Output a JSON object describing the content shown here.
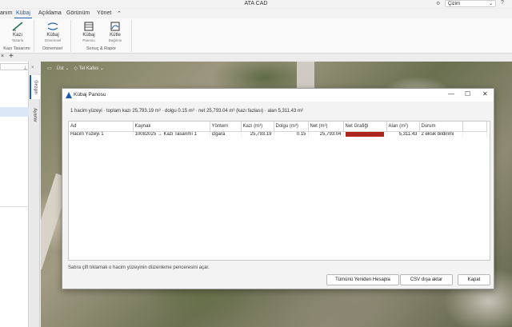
{
  "app": {
    "title": "ATA CAD",
    "workspace": "Çizim"
  },
  "menu": {
    "tabs": [
      "anım",
      "Kübaj",
      "Açıklama",
      "Görünüm",
      "Yönet"
    ],
    "active": "Kübaj"
  },
  "ribbon": {
    "groups": [
      {
        "label": "Kazı Tasarımı",
        "buttons": [
          {
            "label": "Kazı",
            "sub": "Tasarla"
          }
        ]
      },
      {
        "label": "Dönemsel",
        "buttons": [
          {
            "label": "Kübaj",
            "sub": "Dönemsel"
          }
        ]
      },
      {
        "label": "Sonuç & Rapor",
        "buttons": [
          {
            "label": "Kübaj",
            "sub": "Panosu"
          },
          {
            "label": "Kütle",
            "sub": "Dağılımı"
          }
        ]
      }
    ]
  },
  "side_tabs": [
    "Gezgin",
    "Ayarlar"
  ],
  "viewport": {
    "toolbar": [
      "Üst",
      "Tel Kafes"
    ]
  },
  "dialog": {
    "title": "Kübaj Panosu",
    "summary": "1 hacim yüzeyi · toplam kazı 25,793.19 m³ · dolgu 0.15 m³ · net 25,793.04 m³ (kazı fazlası) · alan 5,311.43 m²",
    "columns": [
      "Ad",
      "Kaynak",
      "Yöntem",
      "Kazı (m³)",
      "Dolgu (m³)",
      "Net (m³)",
      "Net Grafiği",
      "Alan (m²)",
      "Durum"
    ],
    "rows": [
      {
        "ad": "Hacim Yüzeyi 1",
        "kaynak": "10082025 → Kazı Tasarımı 1",
        "yontem": "ızgara",
        "kazi": "25,793.19",
        "dolgu": "0.15",
        "net": "25,793.04",
        "net_fraction": 1.0,
        "alan": "5,311.43",
        "durum": "2 eksik bildirimi"
      }
    ],
    "bar_color": "#b0251f",
    "hint": "Satıra çift tıklamak o hacim yüzeyinin düzenleme penceresini açar.",
    "buttons": {
      "recalc": "Tümünü Yeniden Hesapla",
      "csv": "CSV dışa aktar",
      "close": "Kapat"
    }
  }
}
